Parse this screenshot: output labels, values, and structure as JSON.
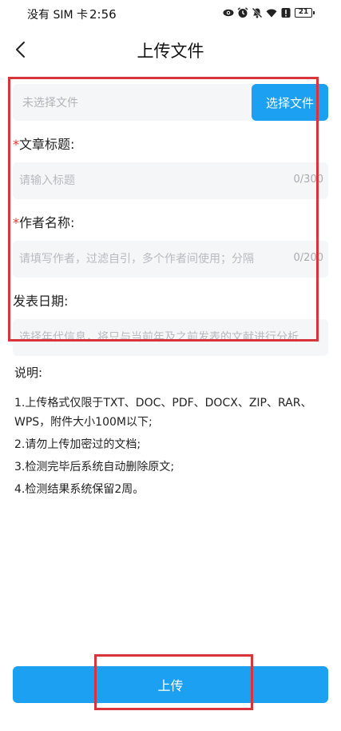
{
  "status_bar": {
    "carrier": "没有 SIM 卡",
    "time": "2:56",
    "battery": "21",
    "icons": [
      "eye-icon",
      "alarm-icon",
      "mute-icon",
      "wifi-icon",
      "alert-icon",
      "battery-icon"
    ]
  },
  "header": {
    "title": "上传文件",
    "back_icon": "chevron-left-icon"
  },
  "file_select": {
    "placeholder": "未选择文件",
    "button_label": "选择文件"
  },
  "fields": {
    "title": {
      "required_mark": "*",
      "label": "文章标题:",
      "placeholder": "请输入标题",
      "counter": "0/300"
    },
    "author": {
      "required_mark": "*",
      "label": "作者名称:",
      "placeholder": "请填写作者，过滤自引，多个作者间使用；分隔",
      "counter": "0/200"
    },
    "date": {
      "label": "发表日期:",
      "placeholder": "选择年代信息，将只与当前年及之前发表的文献进行分析"
    }
  },
  "notes": {
    "title": "说明:",
    "items": [
      "1.上传格式仅限于TXT、DOC、PDF、DOCX、ZIP、RAR、WPS，附件大小100M以下;",
      "2.请勿上传加密过的文档;",
      "3.检测完毕后系统自动删除原文;",
      "4.检测结果系统保留2周。"
    ]
  },
  "upload_button": {
    "label": "上传"
  },
  "colors": {
    "primary": "#1ca0f2",
    "required": "#e6342a",
    "highlight": "#d8343c",
    "input_bg": "#f5f6f8"
  }
}
